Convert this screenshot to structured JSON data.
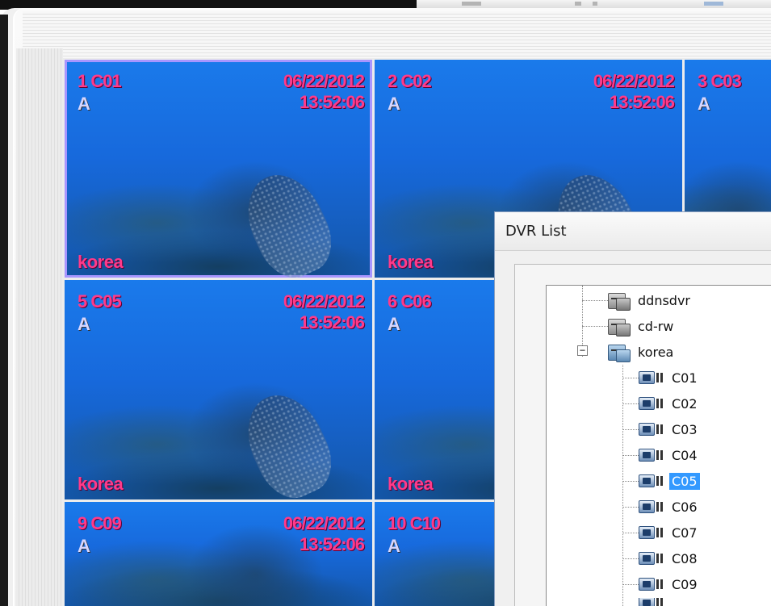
{
  "cameras": [
    {
      "title": "1 C01",
      "date": "06/22/2012",
      "time": "13:52:06",
      "mode": "A",
      "site": "korea"
    },
    {
      "title": "2 C02",
      "date": "06/22/2012",
      "time": "13:52:06",
      "mode": "A",
      "site": "korea"
    },
    {
      "title": "3 C03",
      "mode": "A"
    },
    {
      "title": "5 C05",
      "date": "06/22/2012",
      "time": "13:52:06",
      "mode": "A",
      "site": "korea"
    },
    {
      "title": "6 C06",
      "mode": "A",
      "site": "korea"
    },
    {
      "title": "9 C09",
      "date": "06/22/2012",
      "time": "13:52:06",
      "mode": "A"
    },
    {
      "title": "10 C10",
      "mode": "A"
    }
  ],
  "dvr_list": {
    "title": "DVR List",
    "devices": [
      {
        "label": "ddnsdvr"
      },
      {
        "label": "cd-rw"
      },
      {
        "label": "korea",
        "expander": "−"
      }
    ],
    "channels": [
      "C01",
      "C02",
      "C03",
      "C04",
      "C05",
      "C06",
      "C07",
      "C08",
      "C09"
    ],
    "selected_channel": "C05"
  },
  "colors": {
    "overlay_text": "#ff3a8a",
    "selection": "#3399ff",
    "tile_selected_border": "#a896ff"
  }
}
